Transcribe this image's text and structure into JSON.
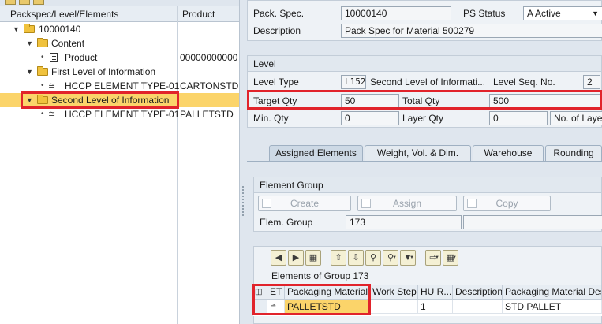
{
  "tree": {
    "col_packspec": "Packspec/Level/Elements",
    "col_product": "Product",
    "rows": [
      {
        "label": "10000140",
        "product": ""
      },
      {
        "label": "Content",
        "product": ""
      },
      {
        "label": "Product",
        "product": "00000000000"
      },
      {
        "label": "First Level of Information",
        "product": ""
      },
      {
        "label": "HCCP ELEMENT TYPE-01",
        "product": "CARTONSTD"
      },
      {
        "label": "Second Level of Information",
        "product": ""
      },
      {
        "label": "HCCP ELEMENT TYPE-01",
        "product": "PALLETSTD"
      }
    ]
  },
  "header": {
    "pack_spec_label": "Pack. Spec.",
    "pack_spec_value": "10000140",
    "ps_status_label": "PS Status",
    "ps_status_value": "A Active",
    "description_label": "Description",
    "description_value": "Pack Spec for Material 500279"
  },
  "level": {
    "section_title": "Level",
    "level_type_label": "Level Type",
    "level_type_value": "L152",
    "level_type_desc": "Second Level of Informati...",
    "level_seq_label": "Level Seq. No.",
    "level_seq_value": "2",
    "target_qty_label": "Target Qty",
    "target_qty_value": "50",
    "total_qty_label": "Total Qty",
    "total_qty_value": "500",
    "min_qty_label": "Min. Qty",
    "min_qty_value": "0",
    "layer_qty_label": "Layer Qty",
    "layer_qty_value": "0",
    "no_of_layers_label": "No. of Laye"
  },
  "tabs": [
    {
      "label": "Assigned Elements"
    },
    {
      "label": "Weight, Vol. & Dim."
    },
    {
      "label": "Warehouse"
    },
    {
      "label": "Rounding"
    }
  ],
  "element_group": {
    "section_title": "Element Group",
    "create_label": "Create",
    "assign_label": "Assign",
    "copy_label": "Copy",
    "elem_group_label": "Elem. Group",
    "elem_group_value": "173"
  },
  "elements_table": {
    "title": "Elements of  Group 173",
    "columns": [
      "ET",
      "Packaging Material",
      "Work Step",
      "HU R...",
      "Description",
      "Packaging Material Des"
    ],
    "row": {
      "et": "",
      "packaging_material": "PALLETSTD",
      "work_step": "",
      "hu_r": "1",
      "description": "",
      "pm_desc": "STD PALLET"
    }
  },
  "colors": {
    "highlight": "#fbd46a",
    "annotation_red": "#e1232b",
    "folder": "#f0c23d"
  }
}
